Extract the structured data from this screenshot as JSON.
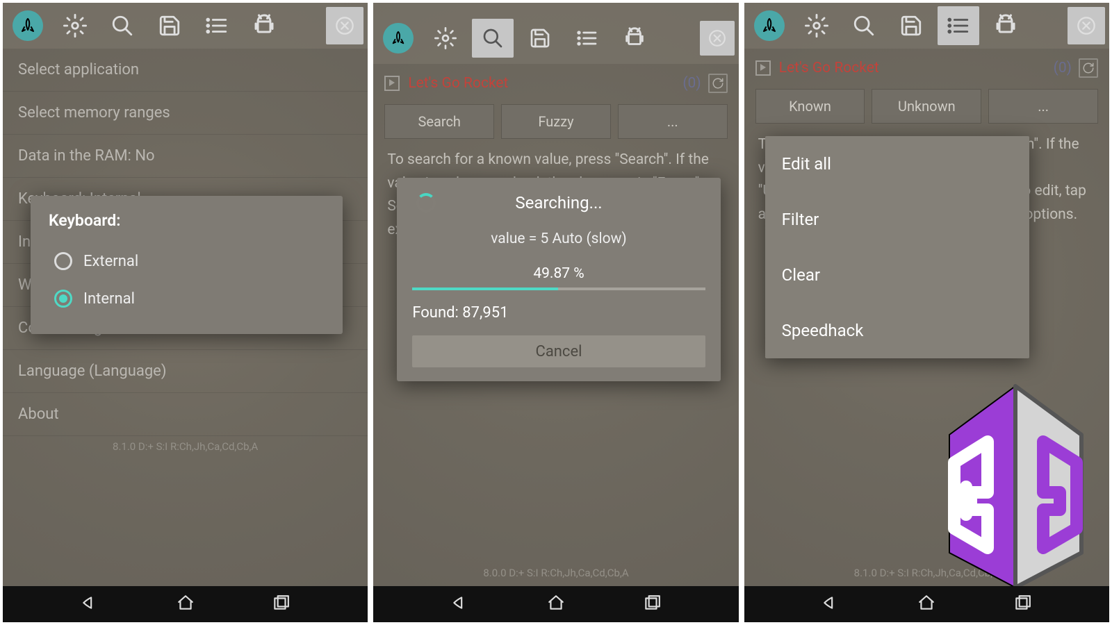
{
  "panel1": {
    "menu": [
      "Select application",
      "Select memory ranges",
      "Data in the RAM: No",
      "Keyboard: Internal",
      "Interface acceleration: Hardware",
      "Write region log",
      "Collect usage stats: Yes",
      "Language (Language)",
      "About"
    ],
    "version": "8.1.0   D:+   S:I   R:Ch,Jh,Ca,Cd,Cb,A",
    "dialog": {
      "title": "Keyboard:",
      "opt1": "External",
      "opt2": "Internal"
    }
  },
  "panel2": {
    "app": "Let's Go Rocket",
    "count": "(0)",
    "buttons": [
      "Search",
      "Fuzzy",
      "..."
    ],
    "hint": "To search for a known value, press \"Search\". If the value is unknown, check the changes via \"Fuzzy\". Search by name or perform a group search. For example, search for \"5\" as Dword or 32-bit.",
    "version": "8.0.0   D:+   S:I   R:Ch,Jh,Ca,Cd,Cb,A",
    "search": {
      "title": "Searching...",
      "sub": "value = 5 Auto (slow)",
      "pct": "49.87 %",
      "pctVal": 49.87,
      "found": "Found: 87,951",
      "cancel": "Cancel"
    }
  },
  "panel3": {
    "app": "Let's Go Rocket",
    "count": "(0)",
    "buttons": [
      "Known",
      "Unknown",
      "..."
    ],
    "hint": "To search for a known value, press \"Known\". If the value is unknown, check the changes via \"Unknown\". Search results appear here. To edit, tap an item or perform a long press for more options.",
    "version": "8.1.0   D:+   S:I   R:Ch,Jh,Ca,Cd,Cb,A",
    "menu": [
      "Edit all",
      "Filter",
      "Clear",
      "Speedhack"
    ]
  }
}
